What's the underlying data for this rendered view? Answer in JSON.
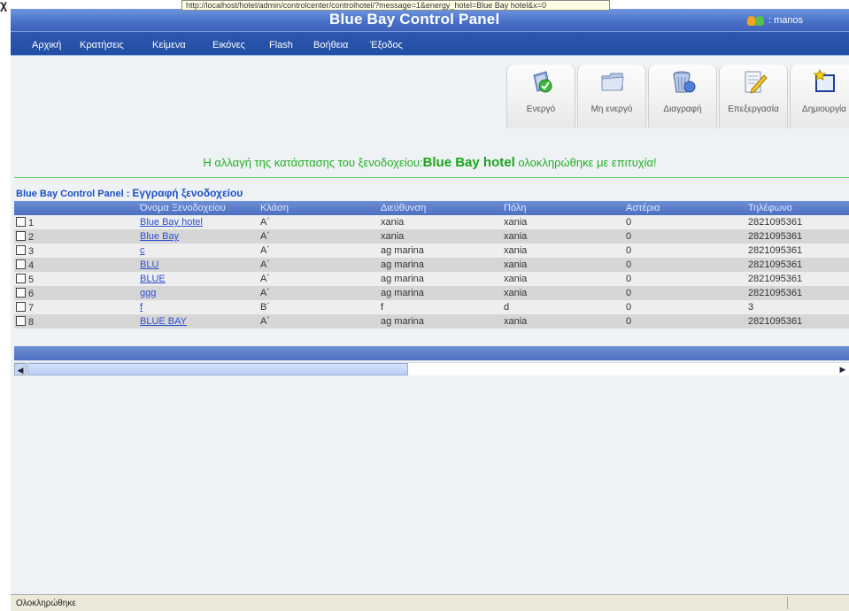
{
  "corner": {
    "text": "χ γι"
  },
  "tooltip": {
    "url": "http://localhost/hotel/admin/controlcenter/controlhotel/?message=1&energy_hotel=Blue Bay hotel&x=0"
  },
  "header": {
    "title": "Blue Bay Control Panel",
    "user": ": manos"
  },
  "nav": {
    "items": [
      {
        "label": "Αρχική"
      },
      {
        "label": "Κρατήσεις"
      },
      {
        "label": "Κείμενα"
      },
      {
        "label": "Εικόνες"
      },
      {
        "label": "Flash"
      },
      {
        "label": "Βοήθεια"
      },
      {
        "label": "Έξοδος"
      }
    ]
  },
  "toolbar": {
    "activate": "Ενεργό",
    "deactivate": "Μη ενεργό",
    "delete": "Διαγραφή",
    "edit": "Επεξεργασία",
    "create": "Δημιουργία"
  },
  "message": {
    "prefix": "Η αλλαγή της κατάστασης του ξενοδοχείου:",
    "hotel": "Blue Bay hotel",
    "suffix": " ολοκληρώθηκε με επιτυχία!"
  },
  "breadcrumb": {
    "root": "Blue Bay Control Panel : ",
    "page": "Εγγραφή ξενοδοχείου"
  },
  "table": {
    "columns": [
      "",
      "Όνομα Ξενοδοχείου",
      "Κλάση",
      "Διεύθυνση",
      "Πόλη",
      "Αστέρια",
      "Τηλέφωνο"
    ],
    "rows": [
      {
        "id": "1",
        "name": "Blue Bay hotel",
        "class": "Α´",
        "address": "xania",
        "city": "xania",
        "stars": "0",
        "phone": "2821095361"
      },
      {
        "id": "2",
        "name": "Blue Bay",
        "class": "Α´",
        "address": "xania",
        "city": "xania",
        "stars": "0",
        "phone": "2821095361"
      },
      {
        "id": "3",
        "name": "c",
        "class": "Α´",
        "address": "ag marina",
        "city": "xania",
        "stars": "0",
        "phone": "2821095361"
      },
      {
        "id": "4",
        "name": "BLU",
        "class": "Α´",
        "address": "ag marina",
        "city": "xania",
        "stars": "0",
        "phone": "2821095361"
      },
      {
        "id": "5",
        "name": "BLUE",
        "class": "Α´",
        "address": "ag marina",
        "city": "xania",
        "stars": "0",
        "phone": "2821095361"
      },
      {
        "id": "6",
        "name": "ggg",
        "class": "Α´",
        "address": "ag marina",
        "city": "xania",
        "stars": "0",
        "phone": "2821095361"
      },
      {
        "id": "7",
        "name": "f",
        "class": "Β´",
        "address": "f",
        "city": "d",
        "stars": "0",
        "phone": "3"
      },
      {
        "id": "8",
        "name": "BLUE BAY",
        "class": "Α´",
        "address": "ag marina",
        "city": "xania",
        "stars": "0",
        "phone": "2821095361"
      }
    ]
  },
  "status": {
    "text": "Ολοκληρώθηκε"
  },
  "colors": {
    "header_blue": "#4a73c8",
    "nav_blue": "#214ea5",
    "success_green": "#22b022",
    "link_blue": "#2a4fd0"
  }
}
